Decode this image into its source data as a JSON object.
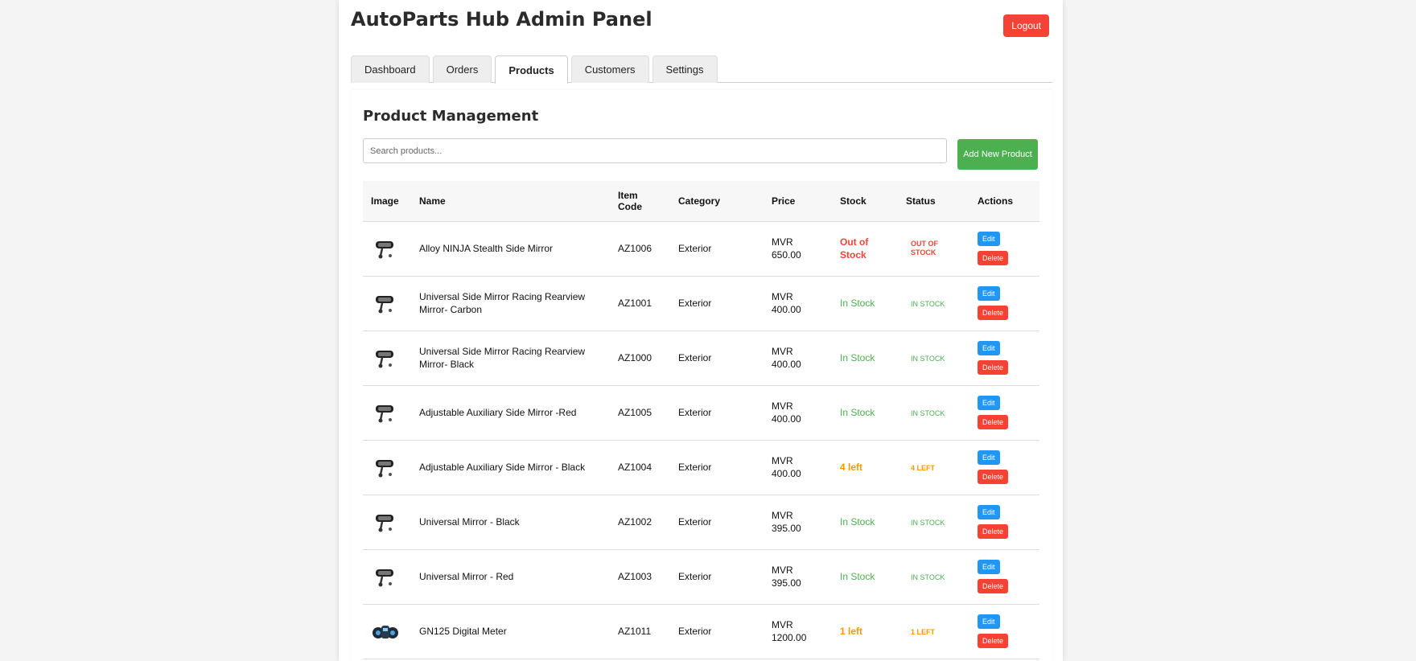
{
  "app": {
    "title": "AutoParts Hub Admin Panel",
    "logout_label": "Logout"
  },
  "tabs": [
    {
      "label": "Dashboard",
      "active": false
    },
    {
      "label": "Orders",
      "active": false
    },
    {
      "label": "Products",
      "active": true
    },
    {
      "label": "Customers",
      "active": false
    },
    {
      "label": "Settings",
      "active": false
    }
  ],
  "panel": {
    "title": "Product Management",
    "search_placeholder": "Search products...",
    "search_value": "",
    "add_label": "Add New Product"
  },
  "table": {
    "headers": [
      "Image",
      "Name",
      "Item Code",
      "Category",
      "Price",
      "Stock",
      "Status",
      "Actions"
    ],
    "edit_label": "Edit",
    "delete_label": "Delete",
    "rows": [
      {
        "icon": "side-mirror-icon",
        "name": "Alloy NINJA Stealth Side Mirror",
        "code": "AZ1006",
        "category": "Exterior",
        "price": "MVR 650.00",
        "stock": "Out of Stock",
        "status": "OUT OF STOCK",
        "tone": "red"
      },
      {
        "icon": "side-mirror-icon",
        "name": "Universal Side Mirror Racing Rearview Mirror- Carbon",
        "code": "AZ1001",
        "category": "Exterior",
        "price": "MVR 400.00",
        "stock": "In Stock",
        "status": "IN STOCK",
        "tone": "green"
      },
      {
        "icon": "side-mirror-icon",
        "name": "Universal Side Mirror Racing Rearview Mirror- Black",
        "code": "AZ1000",
        "category": "Exterior",
        "price": "MVR 400.00",
        "stock": "In Stock",
        "status": "IN STOCK",
        "tone": "green"
      },
      {
        "icon": "side-mirror-icon",
        "name": "Adjustable Auxiliary Side Mirror -Red",
        "code": "AZ1005",
        "category": "Exterior",
        "price": "MVR 400.00",
        "stock": "In Stock",
        "status": "IN STOCK",
        "tone": "green"
      },
      {
        "icon": "side-mirror-icon",
        "name": "Adjustable Auxiliary Side Mirror - Black",
        "code": "AZ1004",
        "category": "Exterior",
        "price": "MVR 400.00",
        "stock": "4 left",
        "status": "4 LEFT",
        "tone": "orange"
      },
      {
        "icon": "side-mirror-icon",
        "name": "Universal Mirror - Black",
        "code": "AZ1002",
        "category": "Exterior",
        "price": "MVR 395.00",
        "stock": "In Stock",
        "status": "IN STOCK",
        "tone": "green"
      },
      {
        "icon": "side-mirror-icon",
        "name": "Universal Mirror - Red",
        "code": "AZ1003",
        "category": "Exterior",
        "price": "MVR 395.00",
        "stock": "In Stock",
        "status": "IN STOCK",
        "tone": "green"
      },
      {
        "icon": "digital-meter-icon",
        "name": "GN125 Digital Meter",
        "code": "AZ1011",
        "category": "Exterior",
        "price": "MVR 1200.00",
        "stock": "1 left",
        "status": "1 LEFT",
        "tone": "orange"
      }
    ]
  },
  "colors": {
    "danger": "#f44336",
    "success": "#4caf50",
    "primary": "#2196f3",
    "warning": "#ff9800"
  }
}
